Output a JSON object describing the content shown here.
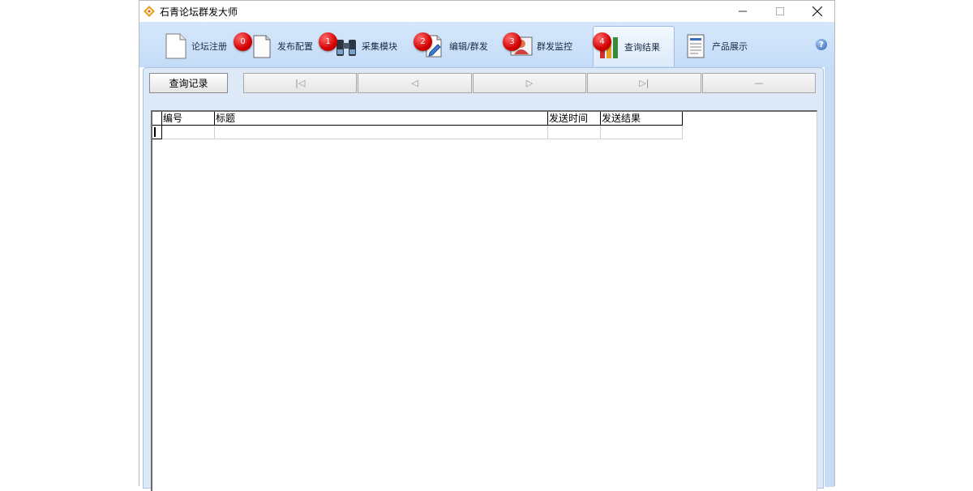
{
  "window": {
    "title": "石青论坛群发大师",
    "controls": {
      "minimize": "—",
      "maximize": "☐",
      "close": "✕"
    }
  },
  "ribbon": {
    "tabs": [
      {
        "label": "论坛注册",
        "badge": "",
        "icon": "blank-document-icon"
      },
      {
        "label": "发布配置",
        "badge": "0",
        "icon": "document-icon"
      },
      {
        "label": "采集模块",
        "badge": "1",
        "icon": "binoculars-icon"
      },
      {
        "label": "编辑/群发",
        "badge": "2",
        "icon": "edit-document-icon"
      },
      {
        "label": "群发监控",
        "badge": "3",
        "icon": "user-monitor-icon"
      },
      {
        "label": "查询结果",
        "badge": "4",
        "icon": "bar-chart-icon",
        "active": true
      },
      {
        "label": "产品展示",
        "badge": "",
        "icon": "report-icon"
      }
    ],
    "help": "?"
  },
  "toolbar": {
    "query_button": "查询记录",
    "nav_buttons": [
      "|◁",
      "◁",
      "▷",
      "▷|",
      "—"
    ]
  },
  "grid": {
    "columns": [
      "编号",
      "标题",
      "发送时间",
      "发送结果"
    ]
  },
  "colors": {
    "ribbon": "#c4dcf8",
    "badge": "#d40000",
    "content": "#dde9f7"
  }
}
